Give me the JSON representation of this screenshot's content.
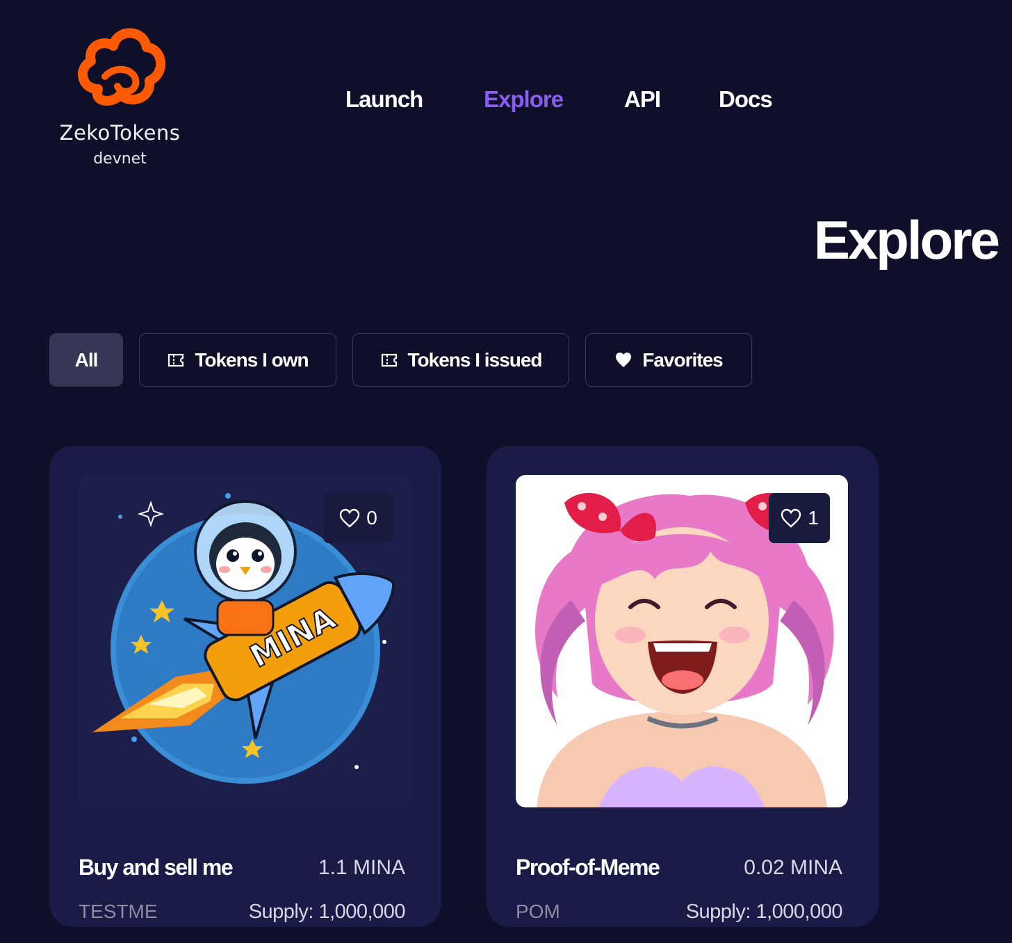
{
  "brand": {
    "name": "ZekoTokens",
    "network": "devnet",
    "logo_color": "#ff5a00"
  },
  "nav": {
    "items": [
      {
        "label": "Launch",
        "active": false
      },
      {
        "label": "Explore",
        "active": true
      },
      {
        "label": "API",
        "active": false
      },
      {
        "label": "Docs",
        "active": false
      }
    ]
  },
  "page_title": "Explore",
  "filters": [
    {
      "label": "All",
      "icon": null,
      "active": true
    },
    {
      "label": "Tokens I own",
      "icon": "ticket-icon",
      "active": false
    },
    {
      "label": "Tokens I issued",
      "icon": "ticket-icon",
      "active": false
    },
    {
      "label": "Favorites",
      "icon": "heart-icon",
      "active": false
    }
  ],
  "tokens": [
    {
      "name": "Buy and sell me",
      "price": "1.1 MINA",
      "symbol": "TESTME",
      "supply": "Supply: 1,000,000",
      "likes": "0",
      "image": "penguin-astronaut-riding-mina-rocket",
      "image_text": "MINA"
    },
    {
      "name": "Proof-of-Meme",
      "price": "0.02 MINA",
      "symbol": "POM",
      "supply": "Supply: 1,000,000",
      "likes": "1",
      "image": "laughing-pink-haired-anime-girl"
    }
  ],
  "colors": {
    "background": "#0f0f29",
    "accent": "#8b5cf6",
    "card": "#1a1b46"
  }
}
